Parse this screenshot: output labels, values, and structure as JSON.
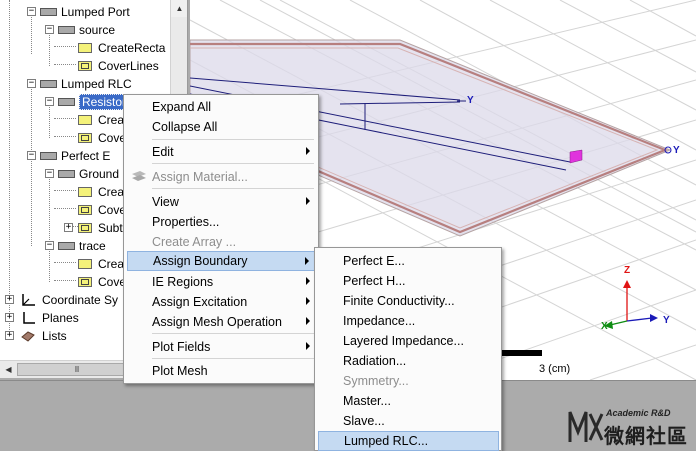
{
  "tree": {
    "items": [
      {
        "label": "Lumped Port"
      },
      {
        "label": "source"
      },
      {
        "label": "CreateRecta"
      },
      {
        "label": "CoverLines"
      },
      {
        "label": "Lumped RLC"
      },
      {
        "label": "Resistor"
      },
      {
        "label": "Crea"
      },
      {
        "label": "Cove"
      },
      {
        "label": "Perfect E"
      },
      {
        "label": "Ground"
      },
      {
        "label": "Crea"
      },
      {
        "label": "Cove"
      },
      {
        "label": "Subt"
      },
      {
        "label": "trace"
      },
      {
        "label": "Crea"
      },
      {
        "label": "Cove"
      },
      {
        "label": "Coordinate Sy"
      },
      {
        "label": "Planes"
      },
      {
        "label": "Lists"
      }
    ],
    "expander_minus": "−",
    "expander_plus": "+",
    "scroll_grip": "III"
  },
  "viewport": {
    "scale_label": "3 (cm)",
    "axes": {
      "z": "Z",
      "y": "Y",
      "x": "X"
    },
    "colors": {
      "background": "#ffffff",
      "grid": "#d4d4d4",
      "board": "#dcd9ea",
      "trace": "#1e1e7a",
      "pad": "#e033dd",
      "axis_z": "#e01414",
      "axis_y": "#1a1ab8",
      "axis_x": "#0e8c12"
    }
  },
  "context_menu": {
    "items": [
      {
        "label": "Expand All"
      },
      {
        "label": "Collapse All"
      },
      {
        "label": "Edit"
      },
      {
        "label": "Assign Material..."
      },
      {
        "label": "View"
      },
      {
        "label": "Properties..."
      },
      {
        "label": "Create Array ..."
      },
      {
        "label": "Assign Boundary"
      },
      {
        "label": "IE Regions"
      },
      {
        "label": "Assign Excitation"
      },
      {
        "label": "Assign Mesh Operation"
      },
      {
        "label": "Plot Fields"
      },
      {
        "label": "Plot Mesh"
      }
    ]
  },
  "boundary_submenu": {
    "items": [
      {
        "label": "Perfect E..."
      },
      {
        "label": "Perfect H..."
      },
      {
        "label": "Finite Conductivity..."
      },
      {
        "label": "Impedance..."
      },
      {
        "label": "Layered Impedance..."
      },
      {
        "label": "Radiation..."
      },
      {
        "label": "Symmetry..."
      },
      {
        "label": "Master..."
      },
      {
        "label": "Slave..."
      },
      {
        "label": "Lumped RLC..."
      }
    ]
  },
  "watermark": {
    "line1": "Academic R&D",
    "line2": "微網社區"
  },
  "colors": {
    "menu_highlight": "#c5daf2",
    "selection": "#3a6ac7",
    "disabled_text": "#8d8d8d"
  }
}
